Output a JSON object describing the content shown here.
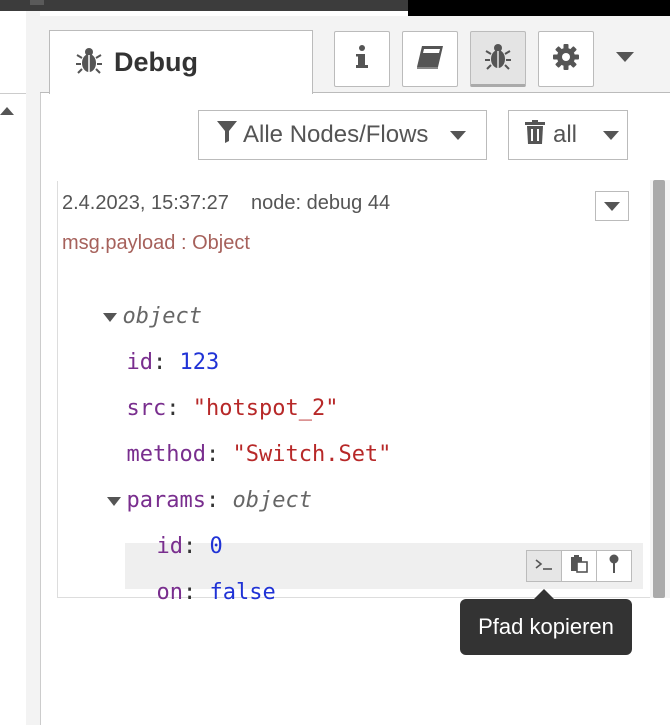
{
  "sidebar": {
    "tab": {
      "label": "Debug",
      "icon": "bug-icon"
    },
    "toolbar_buttons": [
      {
        "name": "info",
        "icon": "info-icon"
      },
      {
        "name": "help",
        "icon": "book-icon"
      },
      {
        "name": "debug",
        "icon": "bug-icon",
        "active": true
      },
      {
        "name": "config",
        "icon": "gear-icon"
      }
    ]
  },
  "debug_toolbar": {
    "filter_label": "Alle Nodes/Flows",
    "clear_label": "all"
  },
  "message": {
    "meta": "2.4.2023, 15:37:27    node: debug 44",
    "topic": "msg.payload : Object",
    "tree": {
      "root_type": "object",
      "id_key": "id",
      "id_value": "123",
      "src_key": "src",
      "src_value": "\"hotspot_2\"",
      "method_key": "method",
      "method_value": "\"Switch.Set\"",
      "params_key": "params",
      "params_type": "object",
      "params_id_key": "id",
      "params_id_value": "0",
      "params_on_key": "on",
      "params_on_value": "false"
    }
  },
  "tooltip": "Pfad kopieren",
  "colors": {
    "key": "#792e8e",
    "number": "#2033d6",
    "string": "#b72828",
    "topic": "#a6615b"
  }
}
